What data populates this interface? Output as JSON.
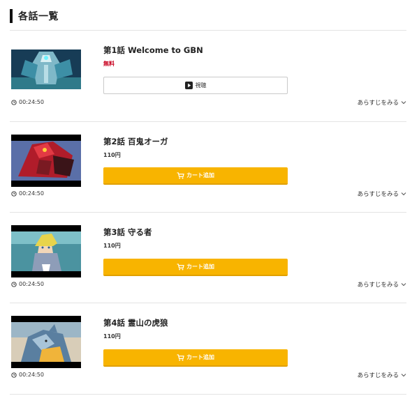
{
  "header": {
    "title": "各話一覧"
  },
  "episodes": [
    {
      "title": "第1話 Welcome to GBN",
      "price": "無料",
      "button": "視聴",
      "duration": "00:24:50",
      "synopsis": "あらすじをみる"
    },
    {
      "title": "第2話 百鬼オーガ",
      "price": "110円",
      "button": "カート追加",
      "duration": "00:24:50",
      "synopsis": "あらすじをみる"
    },
    {
      "title": "第3話 守る者",
      "price": "110円",
      "button": "カート追加",
      "duration": "00:24:50",
      "synopsis": "あらすじをみる"
    },
    {
      "title": "第4話 霊山の虎狼",
      "price": "110円",
      "button": "カート追加",
      "duration": "00:24:50",
      "synopsis": "あらすじをみる"
    }
  ],
  "colors": {
    "accent": "#f8b400",
    "free": "#c8001e"
  },
  "icons": [
    "clock-icon",
    "play-icon",
    "cart-icon",
    "chevron-down-icon"
  ]
}
